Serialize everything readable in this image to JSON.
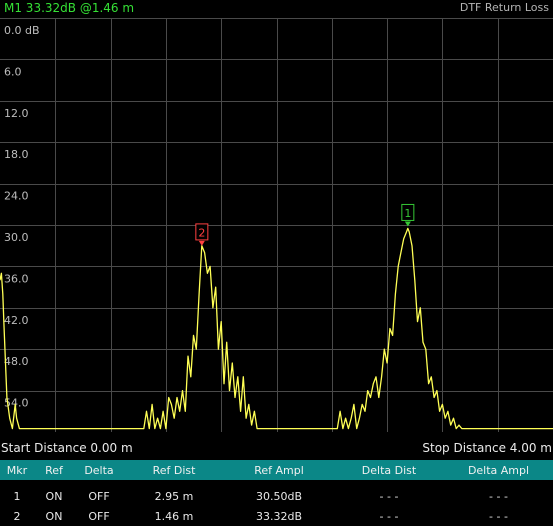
{
  "header": {
    "marker_readout": "M1 33.32dB @1.46 m",
    "title": "DTF Return Loss"
  },
  "chart_data": {
    "type": "line",
    "title": "DTF Return Loss",
    "xlabel": "",
    "ylabel": "",
    "xlim": [
      0,
      4.0
    ],
    "ylim": [
      0,
      60
    ],
    "y_inverted": true,
    "y_ticks": [
      "0.0 dB",
      "6.0",
      "12.0",
      "18.0",
      "24.0",
      "30.0",
      "36.0",
      "42.0",
      "48.0",
      "54.0"
    ],
    "x_divisions": 10,
    "grid": true,
    "trace_color": "#ffff55",
    "series": [
      {
        "x": [
          0.0,
          0.01,
          0.02,
          0.03,
          0.05,
          0.07,
          0.09,
          0.11,
          0.12,
          0.14,
          0.16,
          0.18,
          0.2,
          0.22,
          0.24,
          0.26,
          0.3,
          0.35,
          0.4,
          0.5,
          0.6,
          0.7,
          0.8,
          0.9,
          1.0,
          1.04,
          1.06,
          1.08,
          1.1,
          1.12,
          1.14,
          1.16,
          1.18,
          1.2,
          1.22,
          1.24,
          1.26,
          1.28,
          1.3,
          1.32,
          1.34,
          1.36,
          1.38,
          1.4,
          1.42,
          1.44,
          1.46,
          1.48,
          1.5,
          1.52,
          1.54,
          1.56,
          1.58,
          1.6,
          1.62,
          1.64,
          1.66,
          1.68,
          1.7,
          1.72,
          1.74,
          1.76,
          1.78,
          1.8,
          1.82,
          1.84,
          1.86,
          1.88,
          1.9,
          1.92,
          1.94,
          1.96,
          1.98,
          2.0,
          2.05,
          2.1,
          2.2,
          2.3,
          2.4,
          2.44,
          2.46,
          2.48,
          2.5,
          2.52,
          2.54,
          2.56,
          2.58,
          2.6,
          2.62,
          2.64,
          2.66,
          2.68,
          2.7,
          2.72,
          2.74,
          2.76,
          2.78,
          2.8,
          2.82,
          2.84,
          2.86,
          2.88,
          2.9,
          2.92,
          2.94,
          2.95,
          2.96,
          2.98,
          3.0,
          3.02,
          3.04,
          3.06,
          3.08,
          3.1,
          3.12,
          3.14,
          3.16,
          3.18,
          3.2,
          3.22,
          3.24,
          3.26,
          3.28,
          3.3,
          3.32,
          3.34,
          3.36,
          3.4,
          3.45,
          3.5,
          3.6,
          3.7,
          3.8,
          3.9,
          4.0
        ],
        "y": [
          38,
          37,
          40,
          45,
          55,
          58,
          59.5,
          56,
          58,
          59.5,
          59.5,
          59.5,
          59.5,
          59.5,
          59.5,
          59.5,
          59.5,
          59.5,
          59.5,
          59.5,
          59.5,
          59.5,
          59.5,
          59.5,
          59.5,
          59.5,
          57,
          59.5,
          56,
          59.5,
          58,
          59.5,
          57,
          59.5,
          55,
          56,
          58,
          55,
          57,
          54,
          57,
          49,
          52,
          46,
          48,
          40,
          33,
          34,
          37,
          36,
          42,
          39,
          48,
          44,
          53,
          47,
          54,
          50,
          55,
          52,
          57,
          52,
          58,
          56,
          59,
          57,
          59.5,
          59.5,
          59.5,
          59.5,
          59.5,
          59.5,
          59.5,
          59.5,
          59.5,
          59.5,
          59.5,
          59.5,
          59.5,
          59.5,
          57,
          59.5,
          58,
          59.5,
          58,
          56,
          59.5,
          58,
          56,
          57,
          54,
          55,
          53,
          52,
          55,
          52,
          48,
          50,
          45,
          46,
          40,
          36,
          34,
          32,
          31,
          30.5,
          31,
          33,
          38,
          44,
          42,
          47,
          48,
          53,
          52,
          55,
          54,
          57,
          56,
          58,
          57,
          59,
          58,
          59.5,
          59,
          59.5,
          59.5,
          59.5,
          59.5,
          59.5,
          59.5,
          59.5,
          59.5,
          59.5,
          59.5
        ]
      }
    ],
    "markers": [
      {
        "id": "1",
        "x": 2.95,
        "y": 30.5,
        "color": "#35c835"
      },
      {
        "id": "2",
        "x": 1.46,
        "y": 33.32,
        "color": "#ff4040"
      }
    ]
  },
  "footer": {
    "start_distance": "Start Distance 0.00 m",
    "stop_distance": "Stop Distance 4.00 m"
  },
  "marker_table": {
    "headers": [
      "Mkr",
      "Ref",
      "Delta",
      "Ref Dist",
      "Ref Ampl",
      "Delta Dist",
      "Delta Ampl"
    ],
    "rows": [
      [
        "1",
        "ON",
        "OFF",
        "2.95 m",
        "30.50dB",
        "- - -",
        "- - -"
      ],
      [
        "2",
        "ON",
        "OFF",
        "1.46 m",
        "33.32dB",
        "- - -",
        "- - -"
      ]
    ]
  }
}
